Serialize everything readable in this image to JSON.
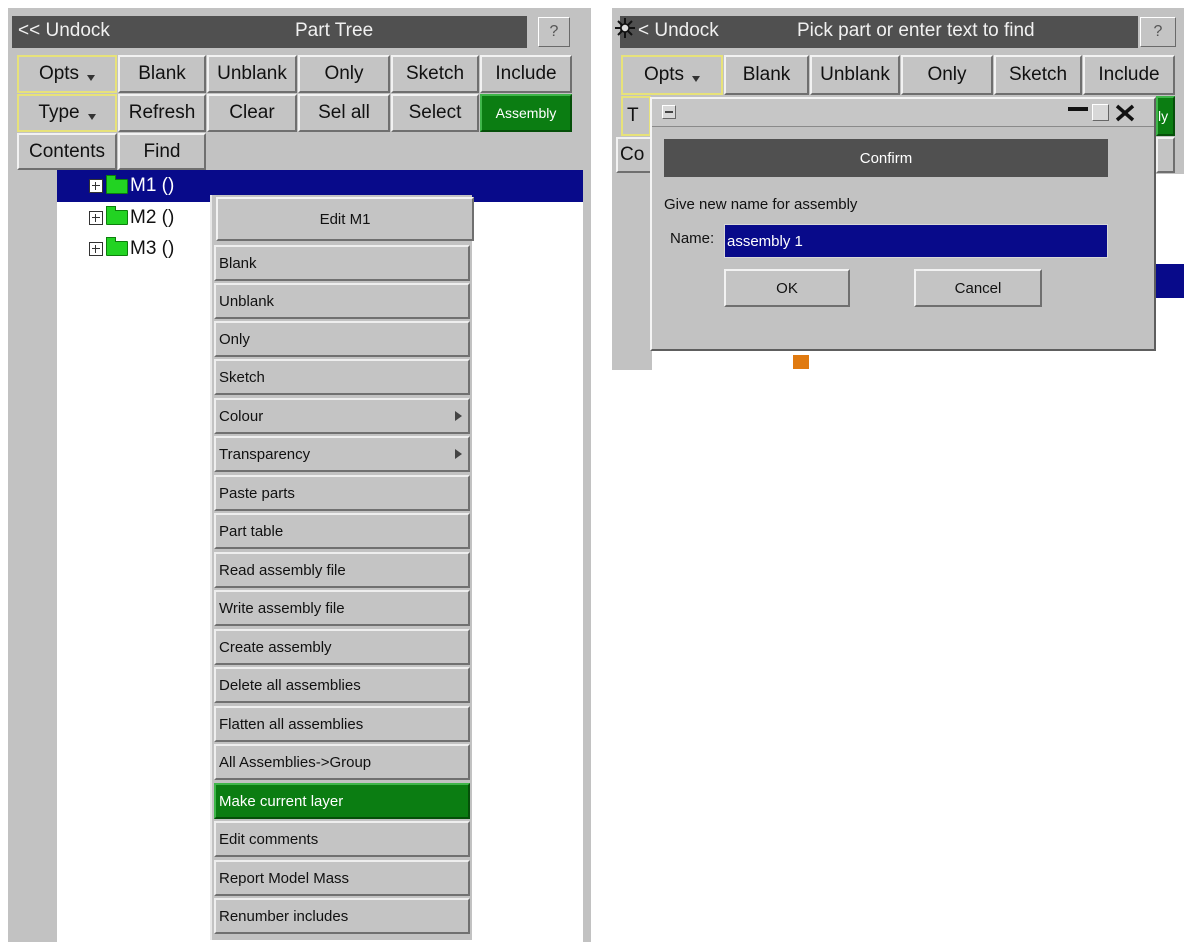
{
  "left": {
    "undock": "<< Undock",
    "title": "Part Tree",
    "help": "?",
    "row1": [
      "Opts",
      "Blank",
      "Unblank",
      "Only",
      "Sketch",
      "Include"
    ],
    "row2": [
      "Type",
      "Refresh",
      "Clear",
      "Sel all",
      "Select",
      "Assembly"
    ],
    "row3": [
      "Contents",
      "Find"
    ],
    "tree": [
      {
        "label": "M1 ()",
        "selected": true
      },
      {
        "label": "M2 ()",
        "selected": false
      },
      {
        "label": "M3 ()",
        "selected": false
      }
    ]
  },
  "context_menu": {
    "header": "Edit M1",
    "items": [
      "Blank",
      "Unblank",
      "Only",
      "Sketch",
      "Colour",
      "Transparency",
      "Paste parts",
      "Part table",
      "Read assembly file",
      "Write assembly file",
      "Create assembly",
      "Delete all assemblies",
      "Flatten all assemblies",
      "All Assemblies->Group",
      "Make current layer",
      "Edit comments",
      "Report Model Mass",
      "Renumber includes"
    ],
    "active_item": "Make current layer"
  },
  "right": {
    "undock": "< Undock",
    "title": "Pick part or enter text to find",
    "help": "?",
    "row1": [
      "Opts",
      "Blank",
      "Unblank",
      "Only",
      "Sketch",
      "Include"
    ],
    "partial_type": "T",
    "partial_contents": "Co",
    "partial_green": "ly"
  },
  "dialog": {
    "title": "Confirm",
    "message": "Give new name for assembly",
    "name_label": "Name:",
    "name_value": "assembly 1",
    "ok": "OK",
    "cancel": "Cancel"
  },
  "colors": {
    "panel_bg": "#c2c2c2",
    "titlebar_bg": "#505050",
    "selection_blue": "#080a8a",
    "active_green": "#0b7d12"
  }
}
